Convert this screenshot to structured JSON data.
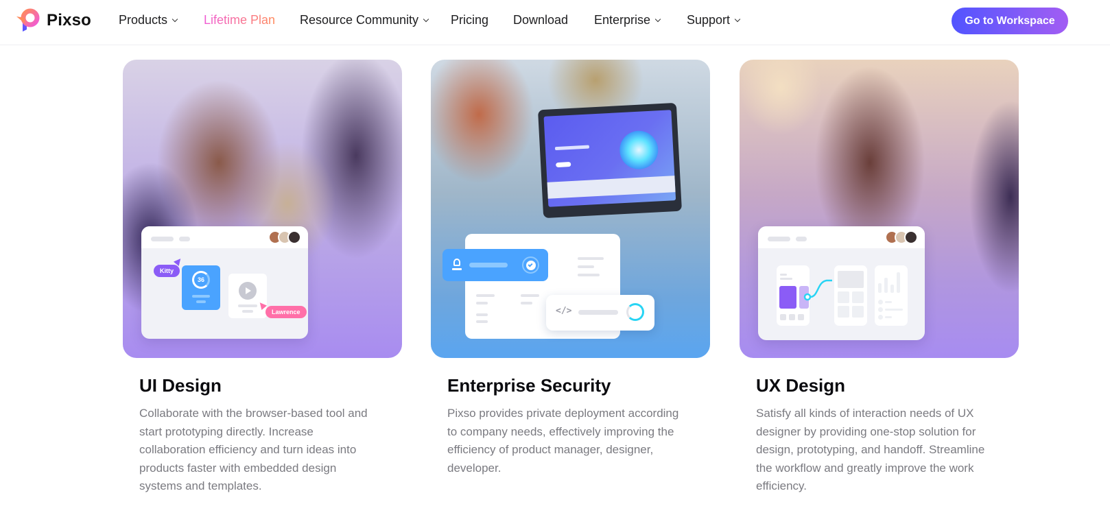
{
  "nav": {
    "brand": "Pixso",
    "items": [
      {
        "label": "Products",
        "dropdown": true
      },
      {
        "label": "Lifetime Plan",
        "dropdown": false,
        "highlight": true
      },
      {
        "label": "Resource Community",
        "dropdown": true
      },
      {
        "label": "Pricing",
        "dropdown": false
      },
      {
        "label": "Download",
        "dropdown": false
      },
      {
        "label": "Enterprise",
        "dropdown": true
      },
      {
        "label": "Support",
        "dropdown": true
      }
    ],
    "cta_label": "Go to Workspace"
  },
  "cards": [
    {
      "title": "UI Design",
      "description": "Collaborate with the browser-based tool and start prototyping directly. Increase collaboration efficiency and turn ideas into products faster with embedded design systems and templates.",
      "mock": {
        "tag_1": "Kitty",
        "tag_2": "Lawrence",
        "progress_value": "36"
      }
    },
    {
      "title": "Enterprise Security",
      "description": "Pixso provides private deployment according to company needs, effectively improving the efficiency of product manager, designer, developer.",
      "mock": {
        "code_icon": "</>"
      }
    },
    {
      "title": "UX Design",
      "description": "Satisfy all kinds of interaction needs of UX designer by providing one-stop solution for design, prototyping, and handoff. Streamline the workflow and greatly improve the work efficiency."
    }
  ],
  "colors": {
    "brand_gradient_start": "#5154ff",
    "brand_gradient_end": "#a25cf3",
    "highlight_gradient_start": "#f05bd5",
    "highlight_gradient_end": "#ff8a5c",
    "accent_blue": "#4aa3ff",
    "accent_purple": "#8b5cf6",
    "accent_pink": "#ff6fa8",
    "accent_cyan": "#28d4f4"
  }
}
